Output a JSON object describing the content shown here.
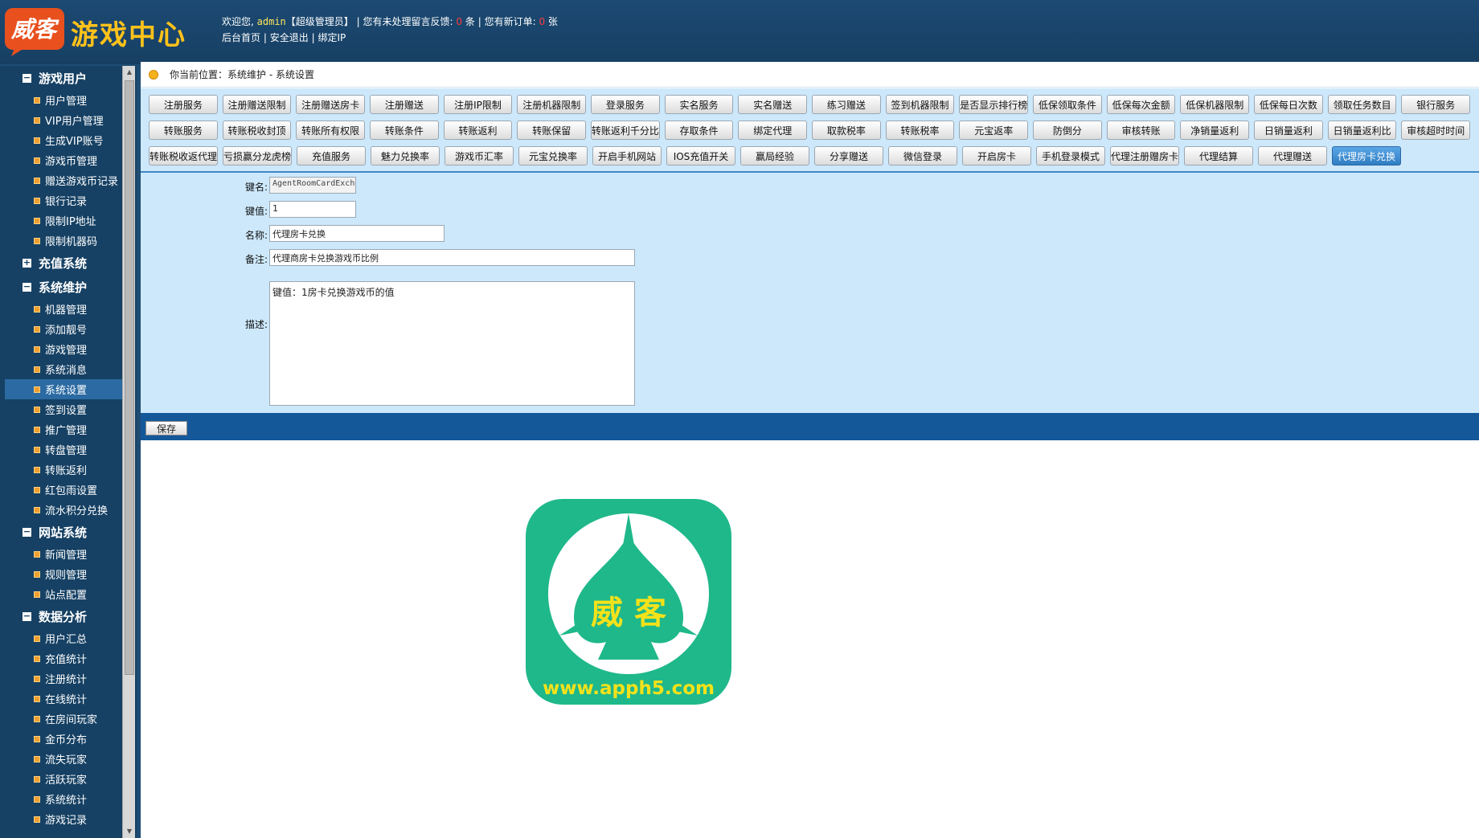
{
  "header": {
    "logo_text": "威客",
    "title": "游戏中心",
    "welcome_prefix": "欢迎您,",
    "username": "admin",
    "role": "【超级管理员】",
    "sep": "|",
    "feedback_label": "您有未处理留言反馈:",
    "feedback_count": "0",
    "feedback_unit": "条",
    "order_label": "您有新订单:",
    "order_count": "0",
    "order_unit": "张",
    "links": [
      "后台首页",
      "安全退出",
      "绑定IP"
    ]
  },
  "sidebar": {
    "groups": [
      {
        "label": "游戏用户",
        "expanded": true,
        "items": [
          "用户管理",
          "VIP用户管理",
          "生成VIP账号",
          "游戏币管理",
          "赠送游戏币记录",
          "银行记录",
          "限制IP地址",
          "限制机器码"
        ]
      },
      {
        "label": "充值系统",
        "expanded": false,
        "items": []
      },
      {
        "label": "系统维护",
        "expanded": true,
        "items": [
          "机器管理",
          "添加靓号",
          "游戏管理",
          "系统消息",
          "系统设置",
          "签到设置",
          "推广管理",
          "转盘管理",
          "转账返利",
          "红包雨设置",
          "流水积分兑换"
        ]
      },
      {
        "label": "网站系统",
        "expanded": true,
        "items": [
          "新闻管理",
          "规则管理",
          "站点配置"
        ]
      },
      {
        "label": "数据分析",
        "expanded": true,
        "items": [
          "用户汇总",
          "充值统计",
          "注册统计",
          "在线统计",
          "在房间玩家",
          "金币分布",
          "流失玩家",
          "活跃玩家",
          "系统统计",
          "游戏记录"
        ]
      }
    ],
    "active_item": "系统设置"
  },
  "breadcrumb": {
    "text": "你当前位置：系统维护 - 系统设置"
  },
  "buttons": {
    "row1": [
      "注册服务",
      "注册赠送限制",
      "注册赠送房卡",
      "注册赠送",
      "注册IP限制",
      "注册机器限制",
      "登录服务",
      "实名服务",
      "实名赠送",
      "练习赠送",
      "签到机器限制",
      "是否显示排行榜",
      "低保领取条件",
      "低保每次金额",
      "低保机器限制",
      "低保每日次数",
      "领取任务数目",
      "银行服务"
    ],
    "row2": [
      "转账服务",
      "转账税收封顶",
      "转账所有权限",
      "转账条件",
      "转账返利",
      "转账保留",
      "转账返利千分比",
      "存取条件",
      "绑定代理",
      "取款税率",
      "转账税率",
      "元宝返率",
      "防倒分",
      "审核转账",
      "净销量返利",
      "日销量返利",
      "日销量返利比",
      "审核超时时间"
    ],
    "row3": [
      "转账税收返代理",
      "亏损赢分龙虎榜",
      "充值服务",
      "魅力兑换率",
      "游戏币汇率",
      "元宝兑换率",
      "开启手机网站",
      "IOS充值开关",
      "赢局经验",
      "分享赠送",
      "微信登录",
      "开启房卡",
      "手机登录模式",
      "代理注册赠房卡",
      "代理结算",
      "代理赠送",
      "代理房卡兑换"
    ],
    "selected": "代理房卡兑换"
  },
  "form": {
    "key_label": "键名:",
    "key_value": "AgentRoomCardExchRat",
    "val_label": "键值:",
    "val_value": "1",
    "name_label": "名称:",
    "name_value": "代理房卡兑换",
    "remark_label": "备注:",
    "remark_value": "代理商房卡兑换游戏币比例",
    "desc_label": "描述:",
    "desc_value": "键值：1房卡兑换游戏币的值",
    "save_label": "保存"
  },
  "app_logo": {
    "text": "威 客",
    "url": "www.apph5.com",
    "color": "#1fb88a"
  },
  "colors": {
    "header_bg": "#1c4a73",
    "panel_bg": "#cde8fb",
    "accent": "#ffc21a",
    "selected_btn": "#3d8fd4"
  }
}
